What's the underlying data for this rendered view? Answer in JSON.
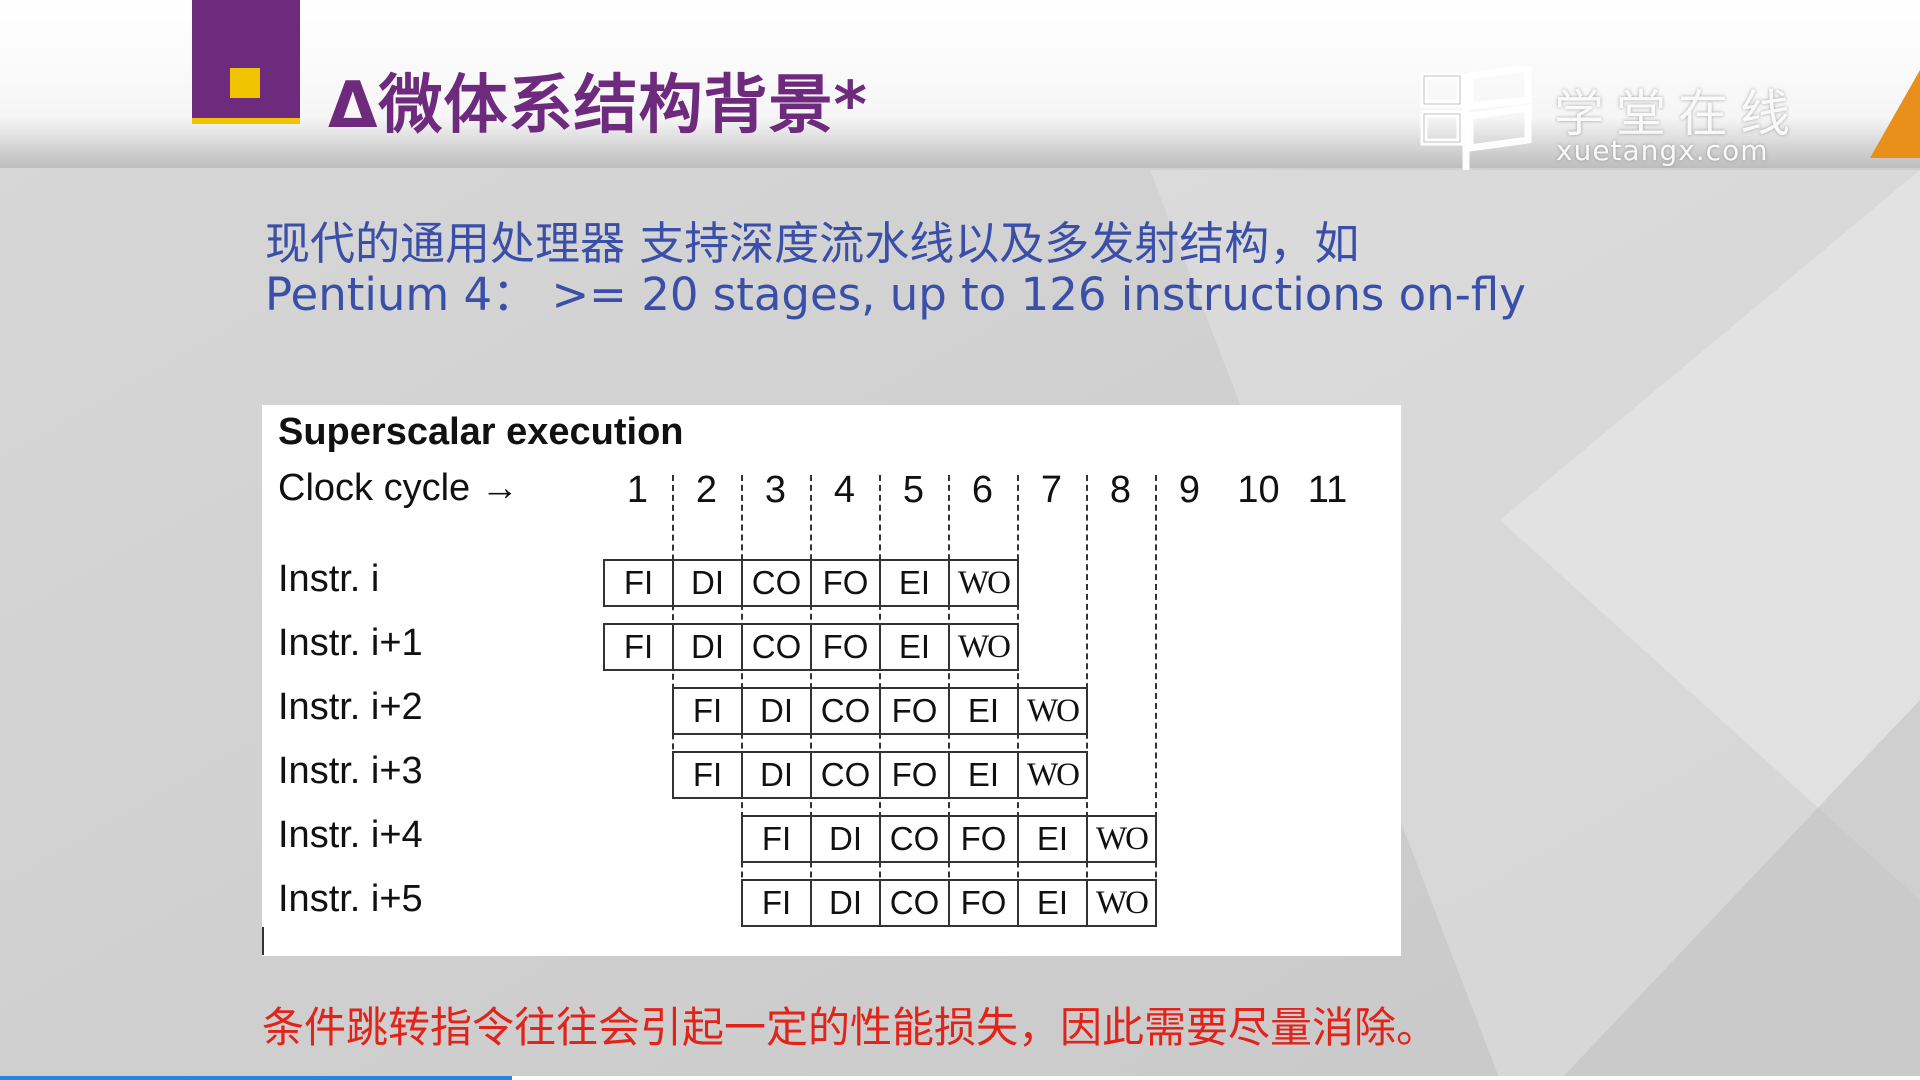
{
  "slide": {
    "title": "Δ微体系结构背景*",
    "watermark": {
      "cn": "学堂在线",
      "en": "xuetangx.com"
    },
    "intro_line1": "现代的通用处理器 支持深度流水线以及多发射结构，如",
    "intro_line2": "Pentium 4： >= 20 stages, up to 126 instructions on-fly",
    "note": "条件跳转指令往往会引起一定的性能损失，因此需要尽量消除。"
  },
  "figure": {
    "title": "Superscalar execution",
    "clock_label": "Clock cycle →",
    "cycles": [
      "1",
      "2",
      "3",
      "4",
      "5",
      "6",
      "7",
      "8",
      "9",
      "10",
      "11"
    ],
    "stages": [
      "FI",
      "DI",
      "CO",
      "FO",
      "EI",
      "WO"
    ],
    "instructions": [
      {
        "label": "Instr. i",
        "start": 1
      },
      {
        "label": "Instr. i+1",
        "start": 1
      },
      {
        "label": "Instr. i+2",
        "start": 2
      },
      {
        "label": "Instr. i+3",
        "start": 2
      },
      {
        "label": "Instr. i+4",
        "start": 3
      },
      {
        "label": "Instr. i+5",
        "start": 3
      }
    ]
  },
  "colors": {
    "accent_purple": "#6e2a7d",
    "accent_yellow": "#f0c400",
    "intro_text": "#3a4fa8",
    "note_text": "#e2231a"
  }
}
